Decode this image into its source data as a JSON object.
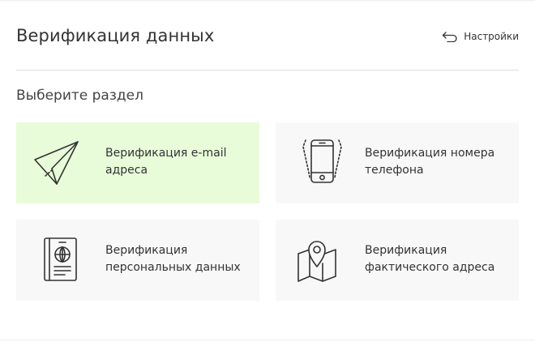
{
  "header": {
    "title": "Верификация данных",
    "settings_label": "Настройки",
    "settings_icon": "back-arrow-icon"
  },
  "section": {
    "label": "Выберите раздел"
  },
  "cards": [
    {
      "label": "Верификация e-mail адреса",
      "icon": "paper-plane-icon",
      "active": true
    },
    {
      "label": "Верификация номера телефона",
      "icon": "phone-icon",
      "active": false
    },
    {
      "label": "Верификация персональных данных",
      "icon": "passport-icon",
      "active": false
    },
    {
      "label": "Верификация фактического адреса",
      "icon": "map-pin-icon",
      "active": false
    }
  ],
  "colors": {
    "active_card_bg": "#e8fcd9",
    "card_bg": "#f8f8f8",
    "text": "#333333"
  }
}
